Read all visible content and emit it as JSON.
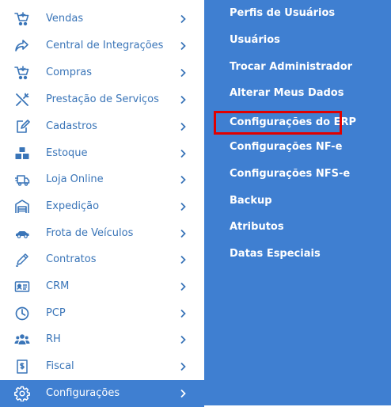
{
  "menu": {
    "items": [
      {
        "label": "Vendas",
        "icon": "cart-icon"
      },
      {
        "label": "Central de Integrações",
        "icon": "share-arrow-icon"
      },
      {
        "label": "Compras",
        "icon": "cart-icon"
      },
      {
        "label": "Prestação de Serviços",
        "icon": "tools-icon"
      },
      {
        "label": "Cadastros",
        "icon": "edit-document-icon"
      },
      {
        "label": "Estoque",
        "icon": "boxes-icon"
      },
      {
        "label": "Loja Online",
        "icon": "delivery-truck-icon"
      },
      {
        "label": "Expedição",
        "icon": "warehouse-icon"
      },
      {
        "label": "Frota de Veículos",
        "icon": "car-icon"
      },
      {
        "label": "Contratos",
        "icon": "pencil-icon"
      },
      {
        "label": "CRM",
        "icon": "id-card-icon"
      },
      {
        "label": "PCP",
        "icon": "clock-icon"
      },
      {
        "label": "RH",
        "icon": "people-icon"
      },
      {
        "label": "Fiscal",
        "icon": "receipt-icon"
      },
      {
        "label": "Configurações",
        "icon": "gear-icon",
        "active": true
      }
    ]
  },
  "submenu": {
    "items": [
      {
        "label": "Perfis de Usuários"
      },
      {
        "label": "Usuários"
      },
      {
        "label": "Trocar Administrador"
      },
      {
        "label": "Alterar Meus Dados"
      },
      {
        "label": "Configurações do ERP",
        "highlighted": true
      },
      {
        "label": "Configurações NF-e"
      },
      {
        "label": "Configurações NFS-e"
      },
      {
        "label": "Backup"
      },
      {
        "label": "Atributos"
      },
      {
        "label": "Datas Especiais"
      }
    ]
  },
  "colors": {
    "accent": "#3f7fd1",
    "menu_text": "#3a75b8",
    "highlight_border": "#e00000"
  }
}
